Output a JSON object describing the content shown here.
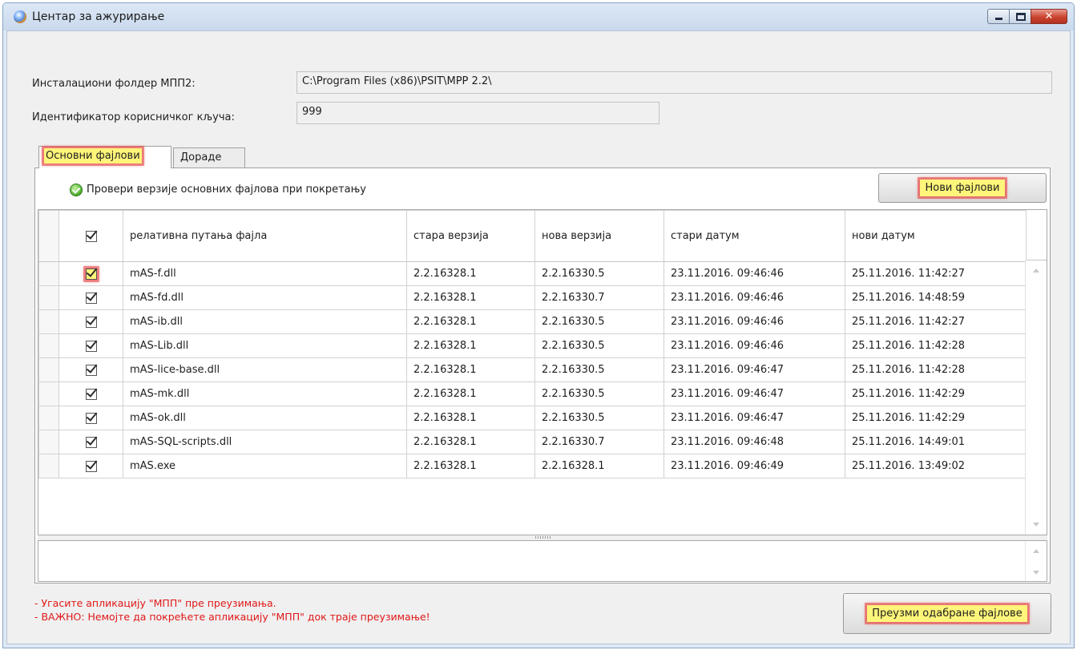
{
  "window": {
    "title": "Центар за ажурирање",
    "minimize_glyph": "",
    "maximize_glyph": "",
    "close_glyph": "✕"
  },
  "form": {
    "install_folder_label": "Инсталациони фолдер МПП2:",
    "install_folder_value": "C:\\Program Files (x86)\\PSIT\\MPP 2.2\\",
    "user_key_label": "Идентификатор корисничког кључа:",
    "user_key_value": "999"
  },
  "tabs": [
    {
      "label": "Основни фајлови",
      "active": true
    },
    {
      "label": "Дораде",
      "active": false
    }
  ],
  "panel": {
    "verify_checkbox_label": "Провери верзије основних фајлова при покретању",
    "new_files_button": "Нови фајлови"
  },
  "grid": {
    "columns": [
      "релативна путања фајла",
      "стара верзија",
      "нова верзија",
      "стари датум",
      "нови датум"
    ],
    "rows": [
      {
        "checked": true,
        "path": "mAS-f.dll",
        "old_version": "2.2.16328.1",
        "new_version": "2.2.16330.5",
        "old_date": "23.11.2016. 09:46:46",
        "new_date": "25.11.2016. 11:42:27"
      },
      {
        "checked": true,
        "path": "mAS-fd.dll",
        "old_version": "2.2.16328.1",
        "new_version": "2.2.16330.7",
        "old_date": "23.11.2016. 09:46:46",
        "new_date": "25.11.2016. 14:48:59"
      },
      {
        "checked": true,
        "path": "mAS-ib.dll",
        "old_version": "2.2.16328.1",
        "new_version": "2.2.16330.5",
        "old_date": "23.11.2016. 09:46:46",
        "new_date": "25.11.2016. 11:42:27"
      },
      {
        "checked": true,
        "path": "mAS-Lib.dll",
        "old_version": "2.2.16328.1",
        "new_version": "2.2.16330.5",
        "old_date": "23.11.2016. 09:46:46",
        "new_date": "25.11.2016. 11:42:28"
      },
      {
        "checked": true,
        "path": "mAS-lice-base.dll",
        "old_version": "2.2.16328.1",
        "new_version": "2.2.16330.5",
        "old_date": "23.11.2016. 09:46:47",
        "new_date": "25.11.2016. 11:42:28"
      },
      {
        "checked": true,
        "path": "mAS-mk.dll",
        "old_version": "2.2.16328.1",
        "new_version": "2.2.16330.5",
        "old_date": "23.11.2016. 09:46:47",
        "new_date": "25.11.2016. 11:42:29"
      },
      {
        "checked": true,
        "path": "mAS-ok.dll",
        "old_version": "2.2.16328.1",
        "new_version": "2.2.16330.5",
        "old_date": "23.11.2016. 09:46:47",
        "new_date": "25.11.2016. 11:42:29"
      },
      {
        "checked": true,
        "path": "mAS-SQL-scripts.dll",
        "old_version": "2.2.16328.1",
        "new_version": "2.2.16330.7",
        "old_date": "23.11.2016. 09:46:48",
        "new_date": "25.11.2016. 14:49:01"
      },
      {
        "checked": true,
        "path": "mAS.exe",
        "old_version": "2.2.16328.1",
        "new_version": "2.2.16328.1",
        "old_date": "23.11.2016. 09:46:49",
        "new_date": "25.11.2016. 13:49:02"
      }
    ]
  },
  "footer": {
    "warning_1": "- Угасите апликацију \"МПП\" пре преузимања.",
    "warning_2": "- ВАЖНО: Немојте да покрећете апликацију \"МПП\" док траје преузимање!",
    "download_button": "Преузми одабране фајлове"
  },
  "colors": {
    "highlight": "#fff57a",
    "warning_text": "#e01818",
    "verify_icon": "#4caf2c"
  }
}
